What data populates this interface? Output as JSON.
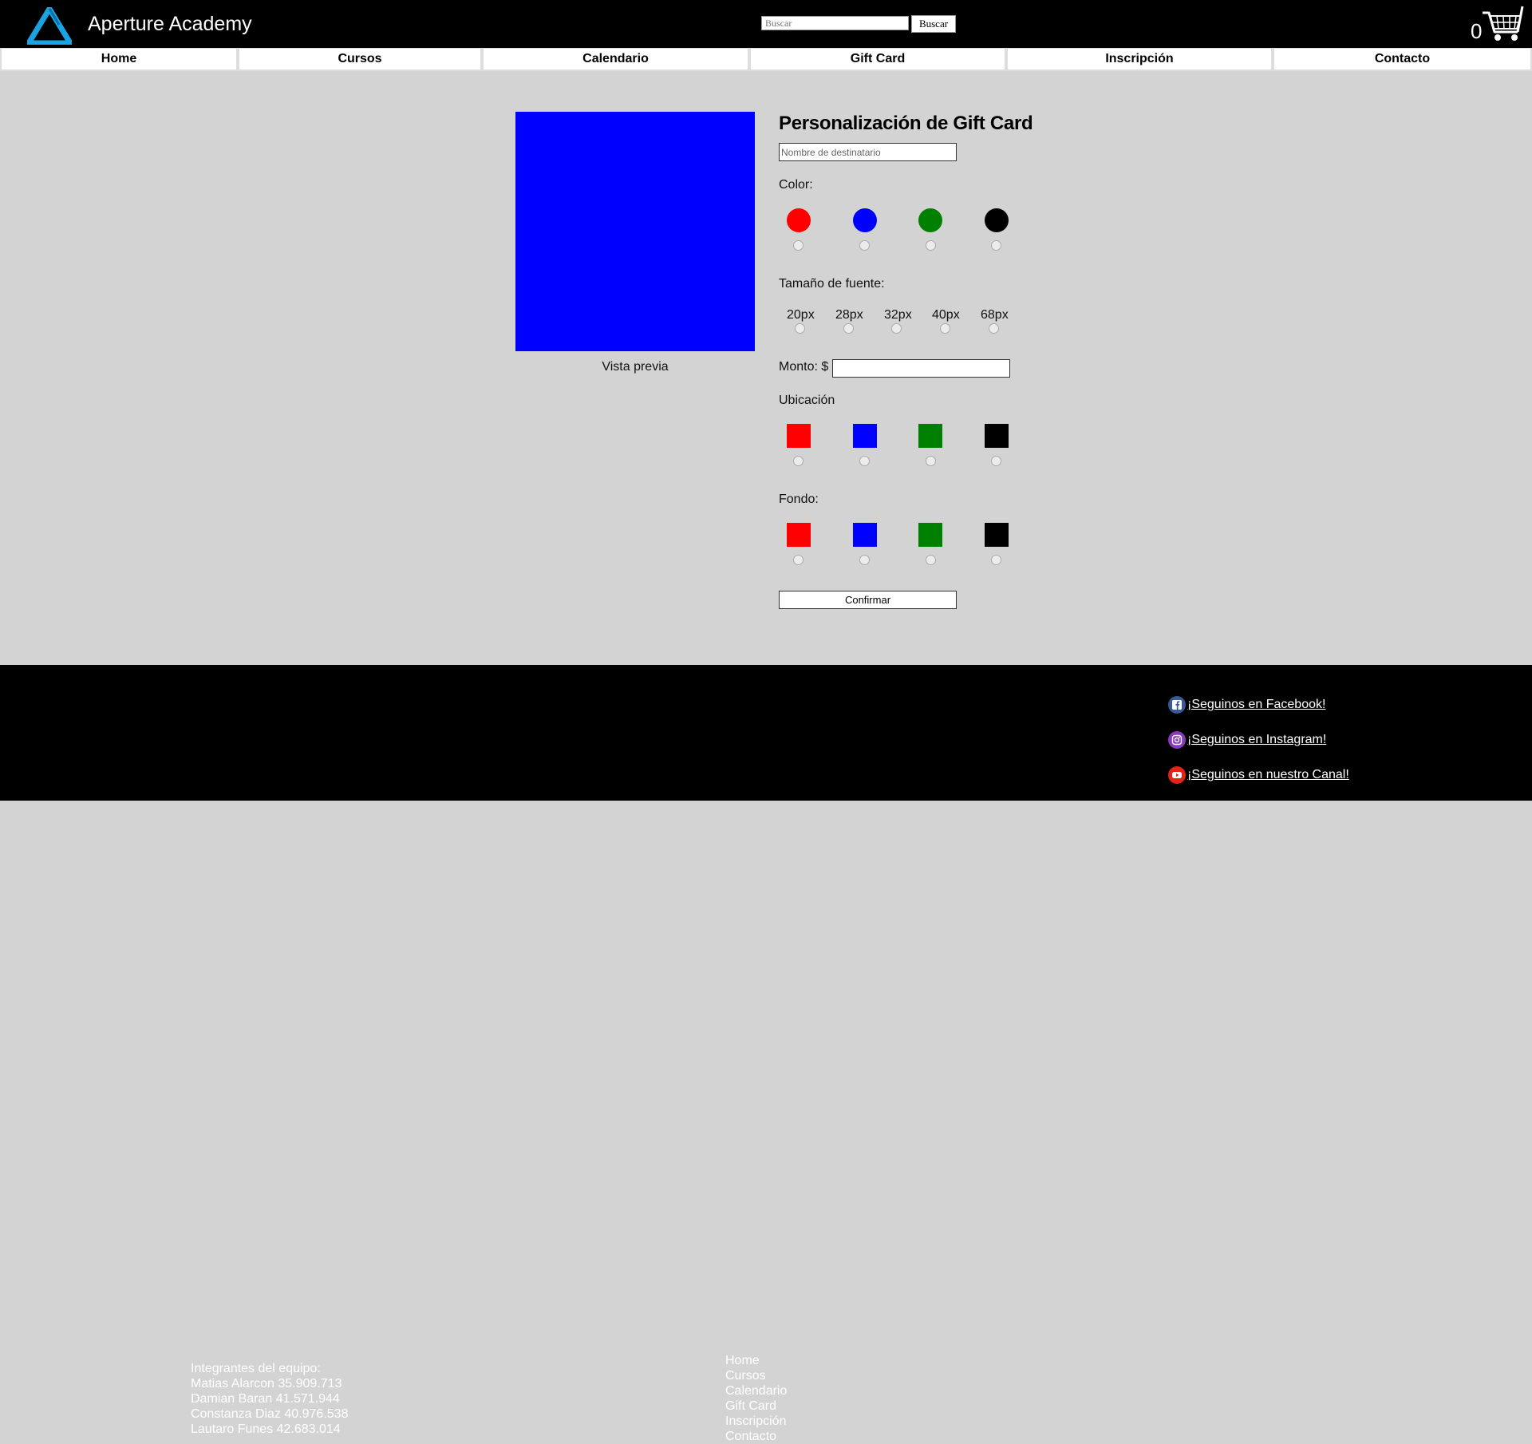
{
  "header": {
    "brand": "Aperture Academy",
    "search_placeholder": "Buscar",
    "search_button": "Buscar",
    "cart_count": "0"
  },
  "nav": [
    {
      "label": "Home"
    },
    {
      "label": "Cursos"
    },
    {
      "label": "Calendario"
    },
    {
      "label": "Gift Card"
    },
    {
      "label": "Inscripción"
    },
    {
      "label": "Contacto"
    }
  ],
  "preview": {
    "label": "Vista previa",
    "color": "#0000ff"
  },
  "form": {
    "title": "Personalización de Gift Card",
    "name_placeholder": "Nombre de destinatario",
    "color_label": "Color:",
    "font_size_label": "Tamaño de fuente:",
    "font_sizes": [
      "20px",
      "28px",
      "32px",
      "40px",
      "68px"
    ],
    "amount_label": "Monto: $",
    "location_label": "Ubicación",
    "background_label": "Fondo:",
    "confirm_button": "Confirmar",
    "swatch_colors": [
      "#ff0000",
      "#0000ff",
      "#008000",
      "#000000"
    ]
  },
  "footer": {
    "team_title": "Integrantes del equipo:",
    "members": [
      "Matias Alarcon 35.909.713",
      "Damian Baran 41.571.944",
      "Constanza Diaz 40.976.538",
      "Lautaro Funes 42.683.014"
    ],
    "links": [
      "Home",
      "Cursos",
      "Calendario",
      "Gift Card",
      "Inscripción",
      "Contacto"
    ],
    "social": [
      {
        "label": "¡Seguinos en Facebook!",
        "icon": "facebook-icon"
      },
      {
        "label": "¡Seguinos en Instagram!",
        "icon": "instagram-icon"
      },
      {
        "label": "¡Seguinos en nuestro Canal!",
        "icon": "youtube-icon"
      }
    ]
  }
}
